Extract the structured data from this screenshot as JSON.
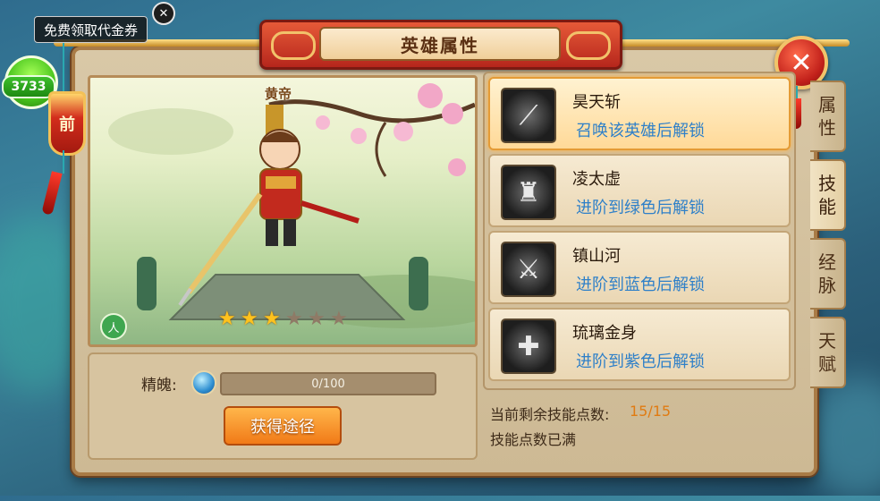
{
  "title": "英雄属性",
  "close_label": "✕",
  "overlay": {
    "voucher_text": "免费领取代金券",
    "voucher_close": "✕",
    "avatar_number": "3733",
    "pendant_label": "前"
  },
  "hero": {
    "name": "黄帝",
    "stars_filled": 3,
    "stars_total": 6,
    "element_icon": "person-icon"
  },
  "essence": {
    "label": "精魄:",
    "progress_text": "0/100",
    "progress_fraction": 0,
    "obtain_label": "获得途径"
  },
  "skills": [
    {
      "name": "昊天斩",
      "status": "召唤该英雄后解锁",
      "active": true,
      "icon": "slash-icon"
    },
    {
      "name": "凌太虚",
      "status": "进阶到绿色后解锁",
      "active": false,
      "icon": "warrior-icon"
    },
    {
      "name": "镇山河",
      "status": "进阶到蓝色后解锁",
      "active": false,
      "icon": "sword-icon"
    },
    {
      "name": "琉璃金身",
      "status": "进阶到紫色后解锁",
      "active": false,
      "icon": "cross-icon"
    }
  ],
  "side_tabs": [
    {
      "label": "属性",
      "active": false
    },
    {
      "label": "技能",
      "active": true
    },
    {
      "label": "经脉",
      "active": false
    },
    {
      "label": "天赋",
      "active": false
    }
  ],
  "skill_points": {
    "label": "当前剩余技能点数:",
    "value": "15/15",
    "full_text": "技能点数已满"
  },
  "colors": {
    "accent_orange": "#f17a17",
    "status_blue": "#2f80c8",
    "banner_red": "#b6261c",
    "star_gold": "#ffc21d"
  }
}
